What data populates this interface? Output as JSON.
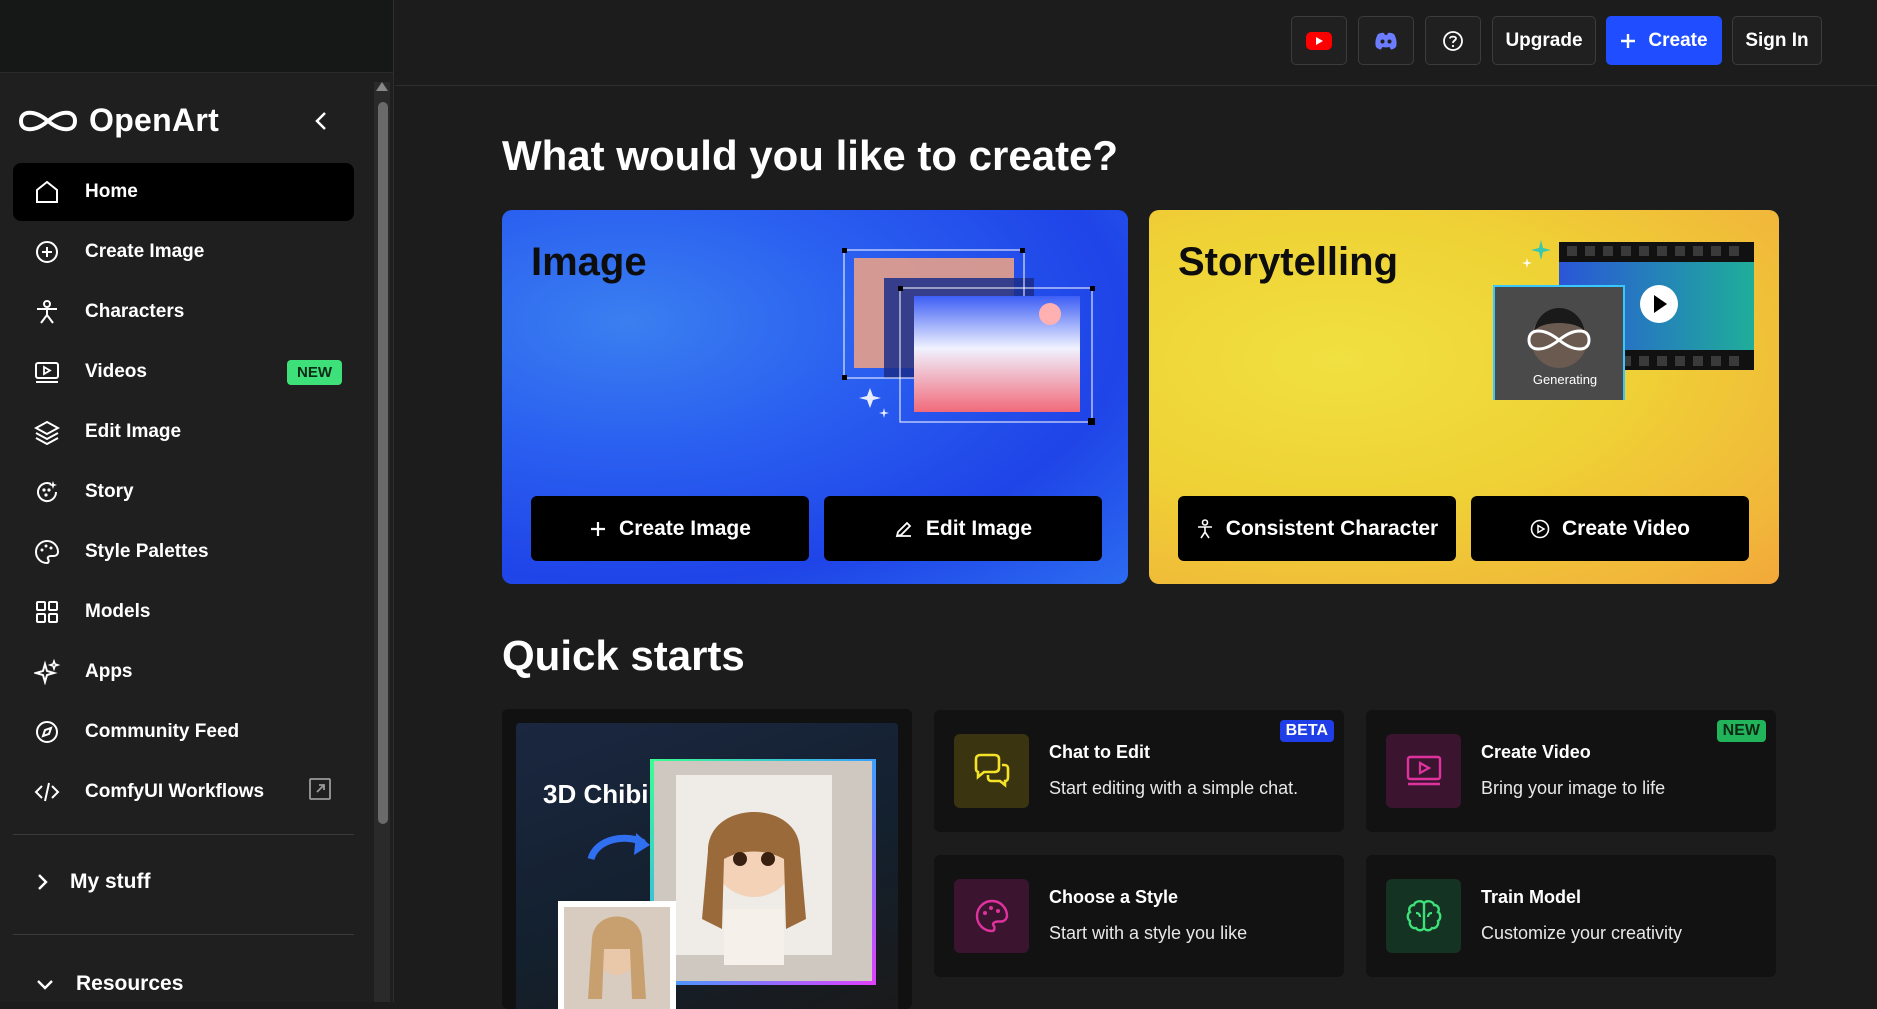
{
  "brand": {
    "name": "OpenArt"
  },
  "sidebar": {
    "items": [
      {
        "label": "Home",
        "icon": "home-icon",
        "active": true
      },
      {
        "label": "Create Image",
        "icon": "plus-circle-icon"
      },
      {
        "label": "Characters",
        "icon": "person-icon"
      },
      {
        "label": "Videos",
        "icon": "video-icon",
        "badge": "NEW"
      },
      {
        "label": "Edit Image",
        "icon": "layers-icon"
      },
      {
        "label": "Story",
        "icon": "story-icon"
      },
      {
        "label": "Style Palettes",
        "icon": "palette-icon"
      },
      {
        "label": "Models",
        "icon": "grid-icon"
      },
      {
        "label": "Apps",
        "icon": "sparkle-icon"
      },
      {
        "label": "Community Feed",
        "icon": "compass-icon"
      },
      {
        "label": "ComfyUI Workflows",
        "icon": "code-icon",
        "external": true
      }
    ],
    "sections": {
      "my_stuff": "My stuff",
      "resources": "Resources"
    }
  },
  "topbar": {
    "upgrade": "Upgrade",
    "create": "Create",
    "sign_in": "Sign In"
  },
  "main": {
    "heading": "What would you like to create?",
    "image_card": {
      "title": "Image",
      "btn1": "Create Image",
      "btn2": "Edit Image"
    },
    "story_card": {
      "title": "Storytelling",
      "btn1": "Consistent Character",
      "btn2": "Create Video",
      "generating": "Generating"
    },
    "quick_heading": "Quick starts",
    "quick_big": {
      "title": "3D Chibi"
    },
    "quick_cards": [
      {
        "title": "Chat to Edit",
        "desc": "Start editing with a simple chat.",
        "badge": "BETA",
        "icon": "chat-icon",
        "color": "#f5e32a",
        "bg": "#3a3510"
      },
      {
        "title": "Create Video",
        "desc": "Bring your image to life",
        "badge": "NEW",
        "icon": "video-play-icon",
        "color": "#e0329e",
        "bg": "#3b1530"
      },
      {
        "title": "Choose a Style",
        "desc": "Start with a style you like",
        "icon": "palette-icon",
        "color": "#e0329e",
        "bg": "#3b1530"
      },
      {
        "title": "Train Model",
        "desc": "Customize your creativity",
        "icon": "brain-icon",
        "color": "#3ee07a",
        "bg": "#143322"
      }
    ]
  },
  "colors": {
    "accent": "#1f4dff",
    "new_badge": "#3ee07a",
    "beta_badge": "#1f3ee8"
  }
}
